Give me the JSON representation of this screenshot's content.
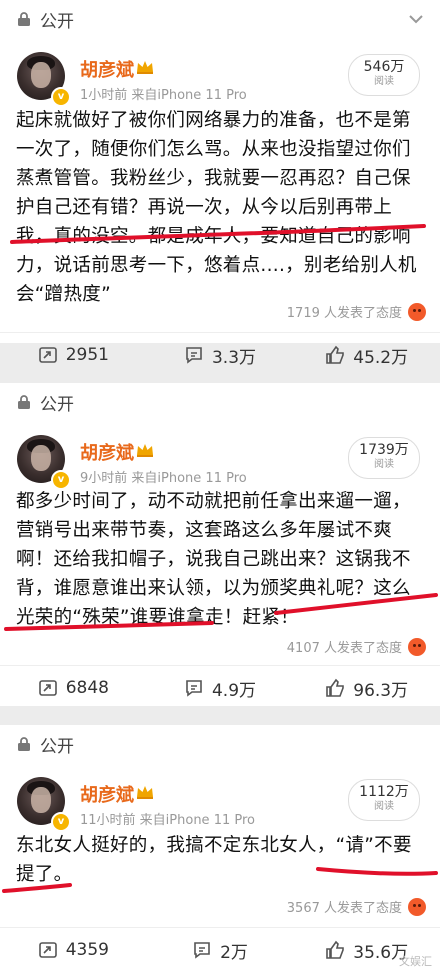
{
  "posts": [
    {
      "visibility": "公开",
      "author": "胡彦斌",
      "meta": "1小时前  来自iPhone 11 Pro",
      "reads_count": "546万",
      "reads_label": "阅读",
      "text": "起床就做好了被你们网络暴力的准备，也不是第一次了，随便你们怎么骂。从来也没指望过你们蒸煮管管。我粉丝少，我就要一忍再忍？自己保护自己还有错？再说一次，从今以后别再带上我，真的没空。都是成年人，要知道自己的影响力，说话前思考一下，悠着点....，别老给别人机会“蹭热度”",
      "attitude": "1719 人发表了态度",
      "repost": "2951",
      "comment": "3.3万",
      "like": "45.2万"
    },
    {
      "visibility": "公开",
      "author": "胡彦斌",
      "meta": "9小时前  来自iPhone 11 Pro",
      "reads_count": "1739万",
      "reads_label": "阅读",
      "text": "都多少时间了，动不动就把前任拿出来遛一遛，营销号出来带节奏，这套路这么多年屡试不爽啊！还给我扣帽子，说我自己跳出来？这锅我不背，谁愿意谁出来认领，以为颁奖典礼呢？这么光荣的“殊荣”谁要谁拿走！赶紧！",
      "attitude": "4107 人发表了态度",
      "repost": "6848",
      "comment": "4.9万",
      "like": "96.3万"
    },
    {
      "visibility": "公开",
      "author": "胡彦斌",
      "meta": "11小时前  来自iPhone 11 Pro",
      "reads_count": "1112万",
      "reads_label": "阅读",
      "text": "东北女人挺好的，我搞不定东北女人，“请”不要提了。",
      "attitude": "3567 人发表了态度",
      "repost": "4359",
      "comment": "2万",
      "like": "35.6万"
    }
  ],
  "watermark": "文娱汇",
  "colors": {
    "author": "#e8691b",
    "underline": "#e0102a",
    "attitude_face": "#f25a2a"
  }
}
